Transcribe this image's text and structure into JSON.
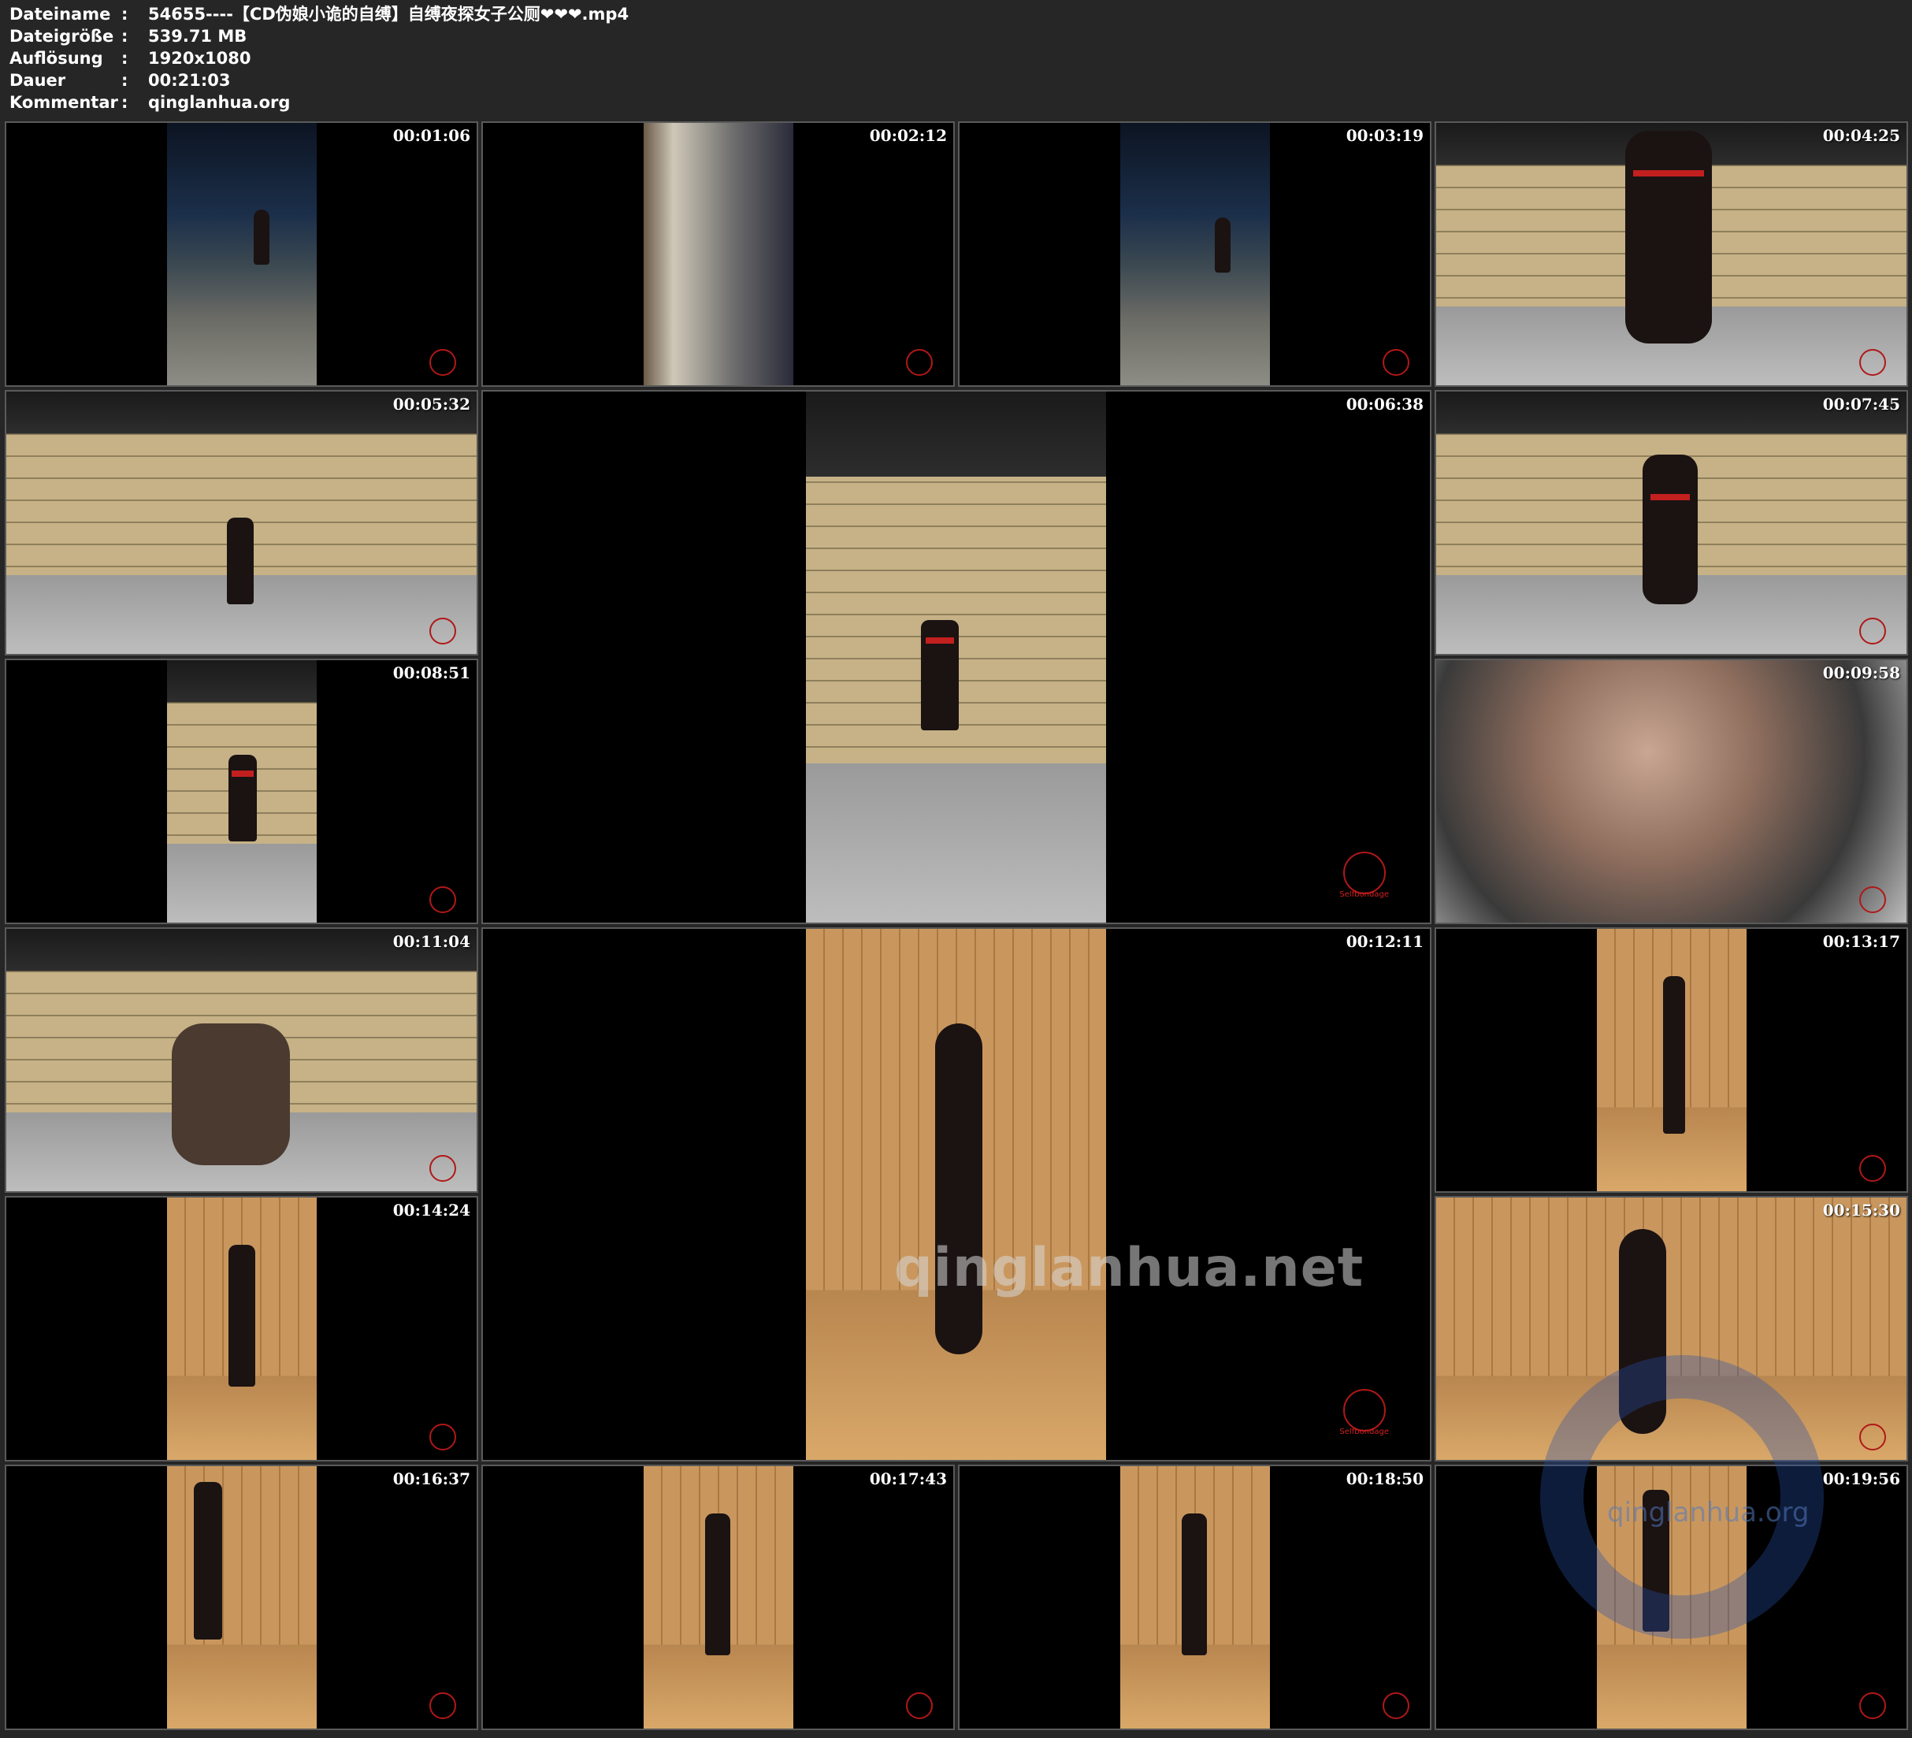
{
  "info": [
    {
      "label": "Dateiname",
      "sep": ":",
      "value": "54655----【CD伪娘小诡的自缚】自缚夜探女子公厕❤❤❤.mp4"
    },
    {
      "label": "Dateigröße",
      "sep": ":",
      "value": "539.71 MB"
    },
    {
      "label": "Auflösung",
      "sep": ":",
      "value": "1920x1080"
    },
    {
      "label": "Dauer",
      "sep": ":",
      "value": "00:21:03"
    },
    {
      "label": "Kommentar",
      "sep": ":",
      "value": "qinglanhua.org"
    }
  ],
  "thumbs": [
    {
      "time": "00:01:06",
      "scene": "night"
    },
    {
      "time": "00:02:12",
      "scene": "night"
    },
    {
      "time": "00:03:19",
      "scene": "night"
    },
    {
      "time": "00:04:25",
      "scene": "brick-wide"
    },
    {
      "time": "00:05:32",
      "scene": "brick-wide"
    },
    {
      "time": "00:06:38",
      "scene": "brick-narrow"
    },
    {
      "time": "00:07:45",
      "scene": "brick-wide"
    },
    {
      "time": "00:08:51",
      "scene": "brick-narrow"
    },
    {
      "time": "00:09:58",
      "scene": "closeup"
    },
    {
      "time": "00:11:04",
      "scene": "brick-wide"
    },
    {
      "time": "00:12:11",
      "scene": "wood-narrow"
    },
    {
      "time": "00:13:17",
      "scene": "wood-narrow"
    },
    {
      "time": "00:14:24",
      "scene": "wood-narrow"
    },
    {
      "time": "00:15:30",
      "scene": "wood-wide"
    },
    {
      "time": "00:16:37",
      "scene": "wood-narrow"
    },
    {
      "time": "00:17:43",
      "scene": "wood-narrow"
    },
    {
      "time": "00:18:50",
      "scene": "wood-narrow"
    },
    {
      "time": "00:19:56",
      "scene": "wood-narrow"
    }
  ],
  "watermarks": {
    "main": "qinglanhua.net",
    "corner": "qinglanhua.org"
  },
  "logo_text": "Selfbondage",
  "colors": {
    "background": "#262626",
    "border": "#5a5a5a",
    "logo": "#b01818"
  }
}
